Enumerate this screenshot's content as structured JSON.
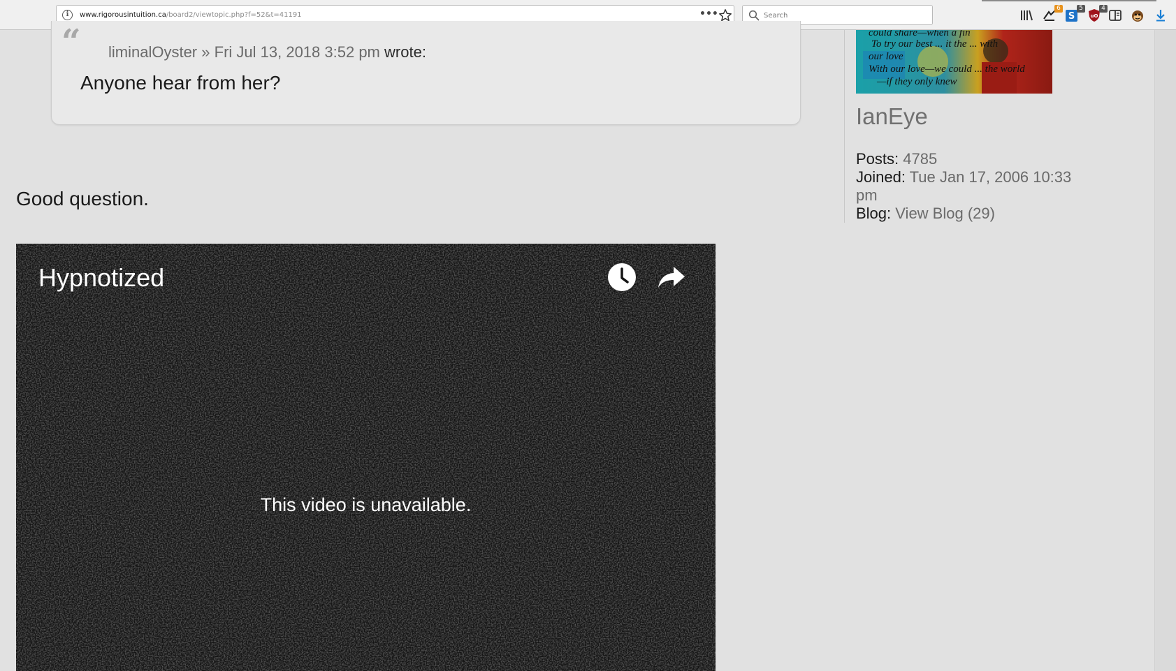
{
  "browser": {
    "url_domain": "www.rigorousintuition.ca",
    "url_path": "/board2/viewtopic.php?f=52&t=41191",
    "page_actions_glyph": "•••",
    "search_placeholder": "Search",
    "toolbar_icons": [
      {
        "name": "library-icon"
      },
      {
        "name": "extension-1-icon",
        "badge": "6",
        "badge_color": "#e8921c"
      },
      {
        "name": "extension-s-icon",
        "badge": "5",
        "badge_color": "#555555"
      },
      {
        "name": "ublock-icon",
        "badge": "4",
        "badge_color": "#555555"
      },
      {
        "name": "reader-view-icon"
      },
      {
        "name": "monkey-icon"
      },
      {
        "name": "download-icon"
      }
    ]
  },
  "quote": {
    "author": "liminalOyster",
    "separator": "»",
    "date": "Fri Jul 13, 2018 3:52 pm",
    "wrote": "wrote:",
    "text": "Anyone hear from her?"
  },
  "post": {
    "text": "Good question."
  },
  "video": {
    "title": "Hypnotized",
    "message": "This video is unavailable."
  },
  "profile": {
    "avatar_lines": [
      "could share—when a fin",
      "To try our best ... it the ... with",
      "our love",
      "With our love—we could ... the world",
      "—if they only knew"
    ],
    "username": "IanEye",
    "posts_label": "Posts:",
    "posts_value": "4785",
    "joined_label": "Joined:",
    "joined_value": "Tue Jan 17, 2006 10:33 pm",
    "blog_label": "Blog:",
    "blog_link": "View Blog (29)"
  },
  "colors": {
    "page_background": "#e1e1e1",
    "video_background": "#141414",
    "link_gray": "#6a6a6a"
  }
}
